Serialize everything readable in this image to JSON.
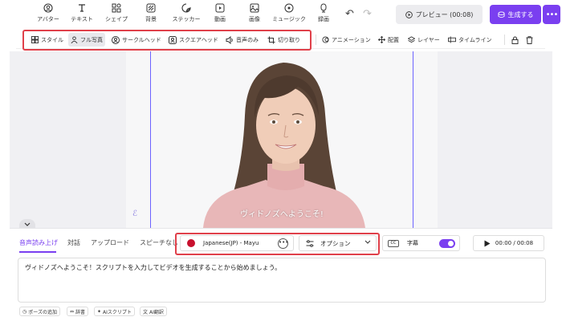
{
  "toolbar": {
    "tools": [
      {
        "label": "アバター",
        "icon": "avatar-icon"
      },
      {
        "label": "テキスト",
        "icon": "text-icon"
      },
      {
        "label": "シェイプ",
        "icon": "shape-icon"
      },
      {
        "label": "背景",
        "icon": "background-icon"
      },
      {
        "label": "ステッカー",
        "icon": "sticker-icon"
      },
      {
        "label": "動画",
        "icon": "video-icon"
      },
      {
        "label": "画像",
        "icon": "image-icon"
      },
      {
        "label": "ミュージック",
        "icon": "music-icon"
      },
      {
        "label": "録画",
        "icon": "record-icon"
      }
    ],
    "undo_icon": "↶",
    "redo_icon": "↷",
    "preview_label": "プレビュー (00:08)",
    "generate_label": "生成する",
    "more_label": "•••"
  },
  "subbar": {
    "style_label": "スタイル",
    "full_photo_label": "フル写真",
    "circle_head_label": "サークルヘッド",
    "square_head_label": "スクエアヘッド",
    "voice_only_label": "音声のみ",
    "crop_label": "切り取り",
    "animation_label": "アニメーション",
    "arrange_label": "配置",
    "layer_label": "レイヤー",
    "timeline_label": "タイムライン"
  },
  "canvas": {
    "subtitle": "ヴィドノズへようこそ!",
    "watermark": "ℰ"
  },
  "panel": {
    "tabs": [
      "音声読み上げ",
      "対話",
      "アップロード",
      "スピーチなし"
    ],
    "voice_label": "Japanese(JP) - Mayu",
    "voice_more": "•••",
    "option_label": "オプション",
    "subtitle_label": "字幕",
    "cc_label": "CC",
    "time_label": "00:00 / 00:08",
    "script_text": "ヴィドノズへようこそ！スクリプトを入力してビデオを生成することから始めましょう。",
    "chips": [
      {
        "icon": "◷",
        "label": "ポーズの追加"
      },
      {
        "icon": "⇔",
        "label": "辞書"
      },
      {
        "icon": "✦",
        "label": "AIスクリプト"
      },
      {
        "icon": "文",
        "label": "AI翻訳"
      }
    ]
  },
  "colors": {
    "accent": "#7a3ff0",
    "highlight": "#e0404a"
  }
}
